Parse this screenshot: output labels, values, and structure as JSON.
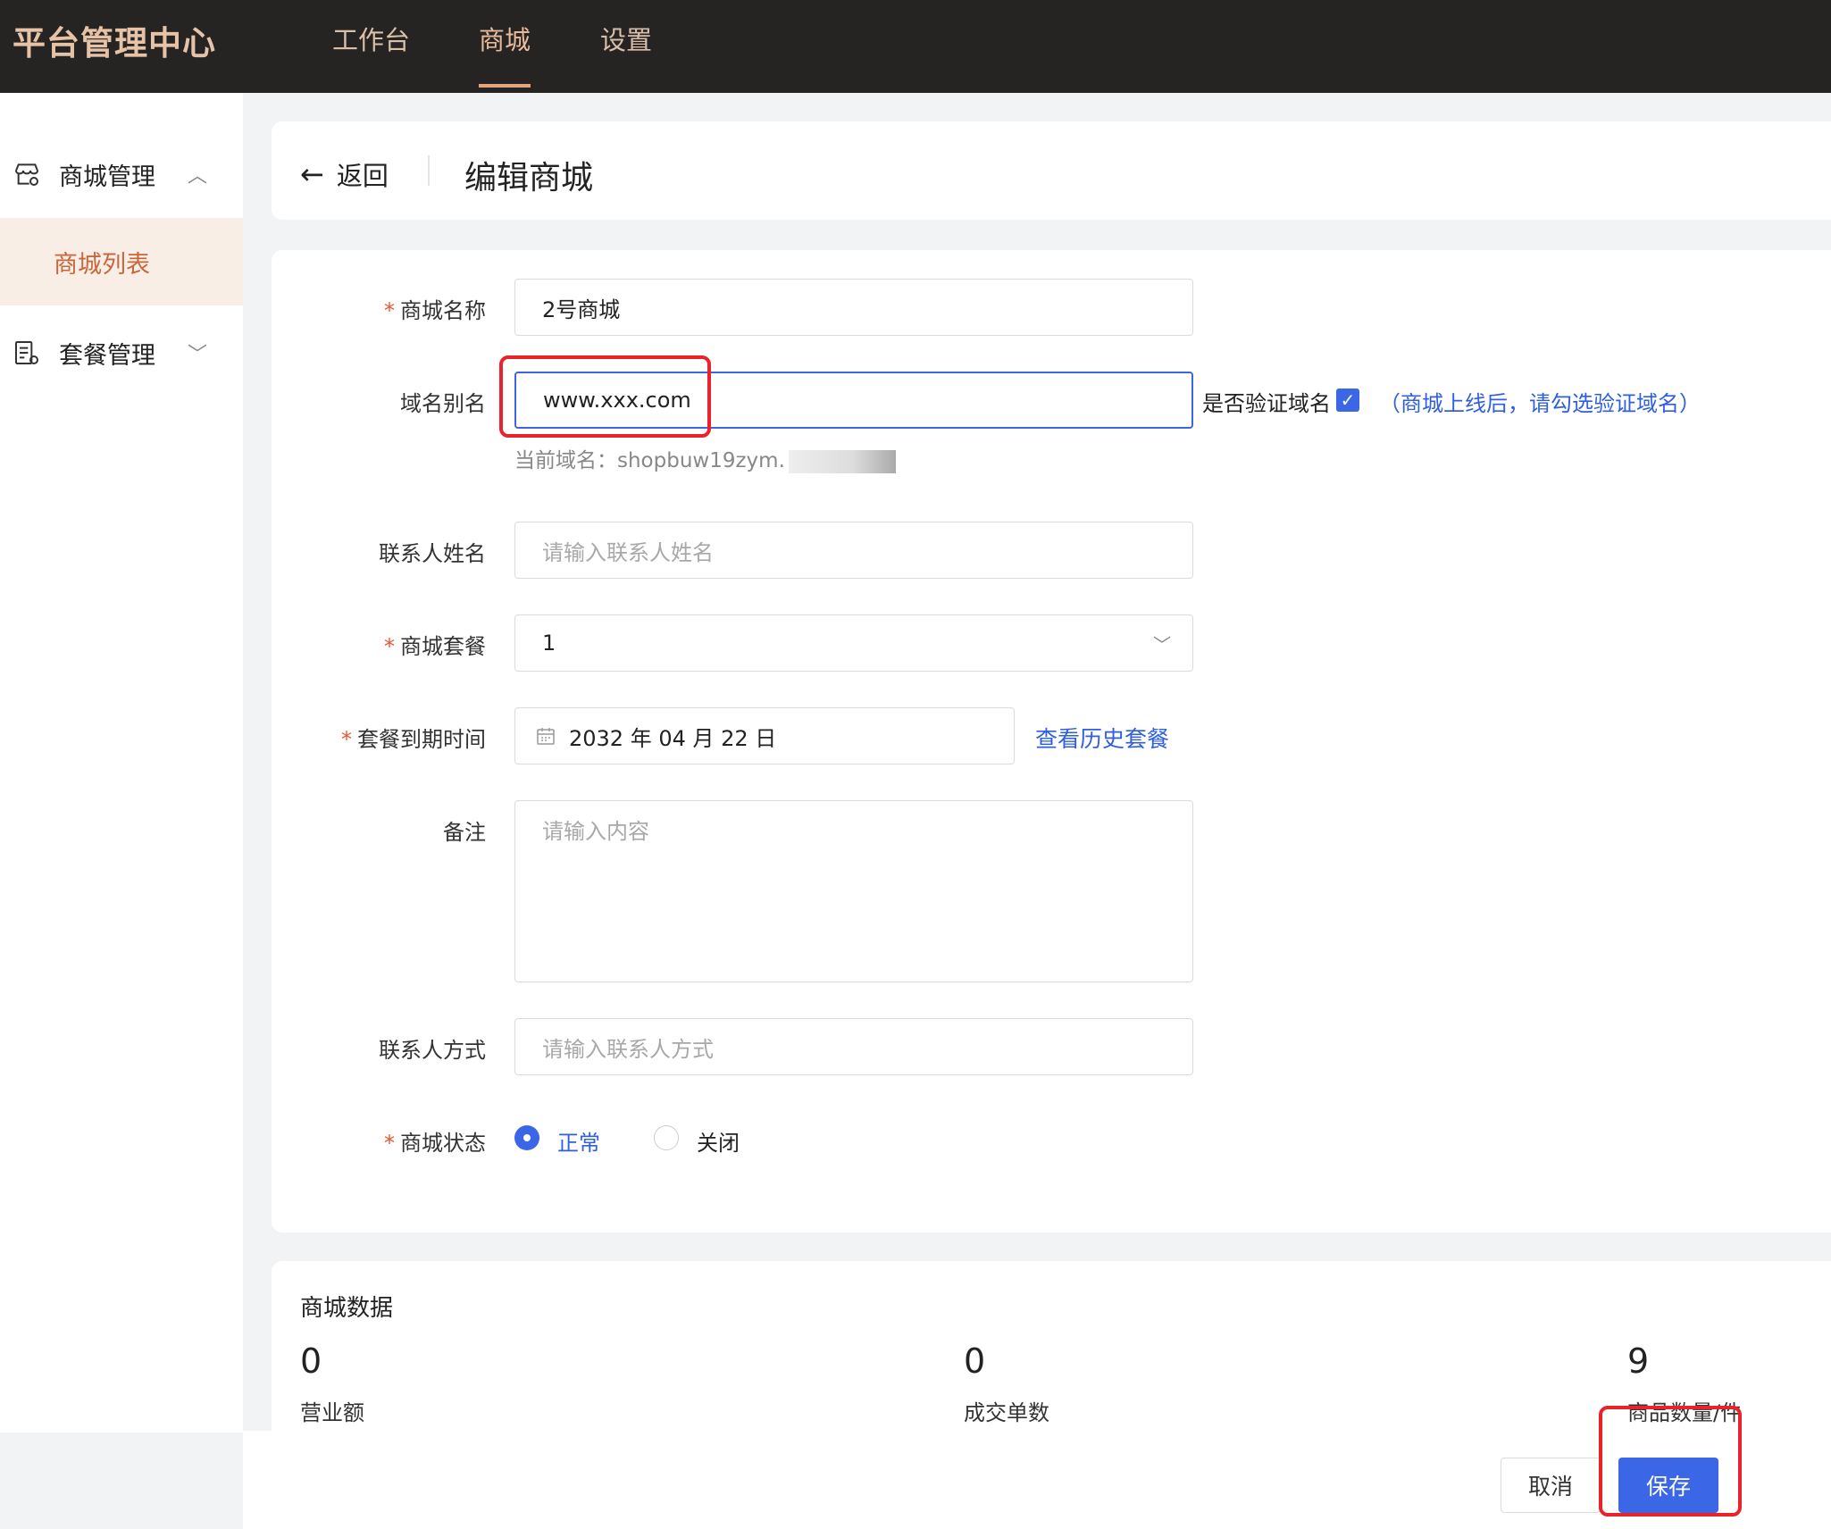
{
  "app": {
    "title": "平台管理中心"
  },
  "nav": {
    "items": [
      {
        "label": "工作台"
      },
      {
        "label": "商城"
      },
      {
        "label": "设置"
      }
    ]
  },
  "sidebar": {
    "groups": [
      {
        "label": "商城管理",
        "children": [
          {
            "label": "商城列表"
          }
        ]
      },
      {
        "label": "套餐管理"
      }
    ]
  },
  "header": {
    "back_label": "返回",
    "title": "编辑商城"
  },
  "form": {
    "name": {
      "label": "商城名称",
      "value": "2号商城"
    },
    "domain": {
      "label": "域名别名",
      "value": "www.xxx.com",
      "verify_label": "是否验证域名",
      "verify_checked": true,
      "verify_note": "（商城上线后，请勾选验证域名）",
      "current_label": "当前域名：shopbuw19zym."
    },
    "contact_name": {
      "label": "联系人姓名",
      "placeholder": "请输入联系人姓名"
    },
    "package": {
      "label": "商城套餐",
      "value": "1"
    },
    "expiry": {
      "label": "套餐到期时间",
      "value": "2032 年 04 月 22 日",
      "history_link": "查看历史套餐"
    },
    "remark": {
      "label": "备注",
      "placeholder": "请输入内容"
    },
    "contact_method": {
      "label": "联系人方式",
      "placeholder": "请输入联系人方式"
    },
    "status": {
      "label": "商城状态",
      "options": [
        "正常",
        "关闭"
      ],
      "selected": "正常"
    }
  },
  "stats": {
    "title": "商城数据",
    "items": [
      {
        "value": "0",
        "label": "营业额"
      },
      {
        "value": "0",
        "label": "成交单数"
      },
      {
        "value": "9",
        "label": "商品数量/件"
      }
    ]
  },
  "footer": {
    "cancel_label": "取消",
    "save_label": "保存"
  },
  "colors": {
    "accent": "#3b66e6",
    "brand": "#e6c3a6",
    "highlight": "#e8232b"
  }
}
